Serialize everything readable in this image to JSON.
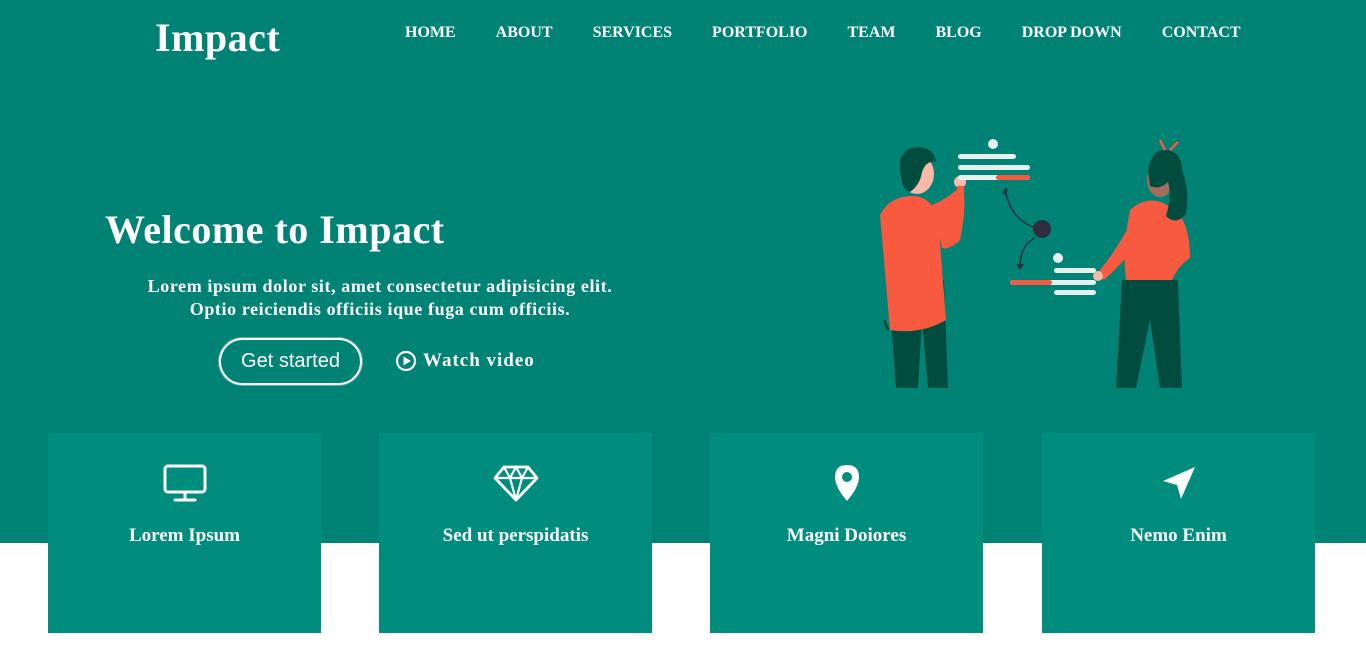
{
  "header": {
    "logo": "Impact",
    "nav": [
      "HOME",
      "ABOUT",
      "SERVICES",
      "PORTFOLIO",
      "TEAM",
      "BLOG",
      "DROP DOWN",
      "CONTACT"
    ]
  },
  "hero": {
    "title": "Welcome to Impact",
    "subtitle_line1": "Lorem ipsum dolor sit, amet consectetur adipisicing elit.",
    "subtitle_line2": "Optio reiciendis officiis ique fuga cum officiis.",
    "get_started": "Get started",
    "watch_video": "Watch video"
  },
  "cards": [
    {
      "title": "Lorem Ipsum",
      "icon": "monitor-icon"
    },
    {
      "title": "Sed ut perspidatis",
      "icon": "diamond-icon"
    },
    {
      "title": "Magni Doiores",
      "icon": "map-pin-icon"
    },
    {
      "title": "Nemo Enim",
      "icon": "navigation-arrow-icon"
    }
  ],
  "colors": {
    "hero_bg": "#008374",
    "card_bg": "#008d7d",
    "accent_orange": "#f85a40",
    "dark_green": "#004d40"
  }
}
